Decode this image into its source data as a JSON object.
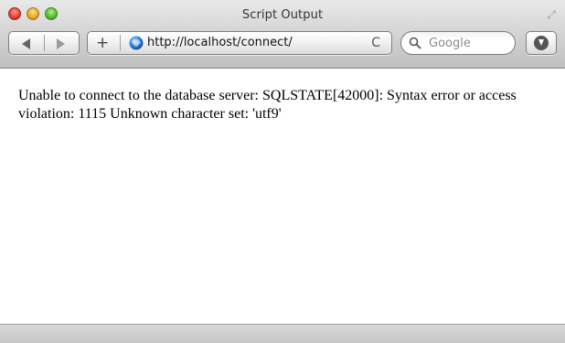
{
  "window": {
    "title": "Script Output"
  },
  "toolbar": {
    "back_icon": "back-arrow-icon",
    "forward_icon": "forward-arrow-icon",
    "add_bookmark_label": "+",
    "address": {
      "url": "http://localhost/connect/",
      "reload_label": "C"
    },
    "search": {
      "placeholder": "Google"
    },
    "download_icon": "download-icon"
  },
  "page": {
    "message": "Unable to connect to the database server: SQLSTATE[42000]: Syntax error or access violation: 1115 Unknown character set: 'utf9'"
  },
  "colors": {
    "close": "#e0443a",
    "minimize": "#e7a92c",
    "maximize": "#5dbb34",
    "globe": "#2f7fd6"
  }
}
